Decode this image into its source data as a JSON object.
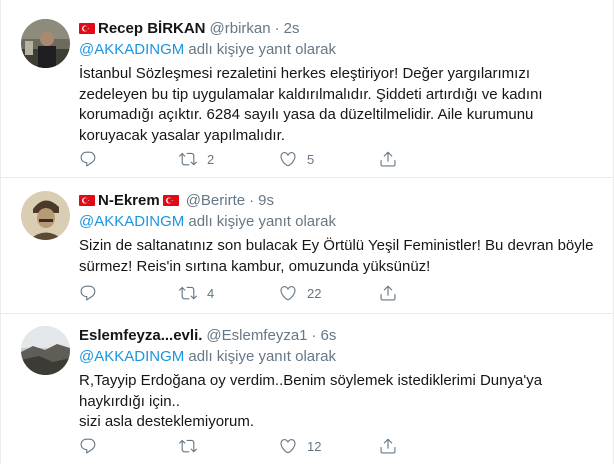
{
  "tweets": [
    {
      "name": "Recep BİRKAN",
      "handle": "@rbirkan",
      "time": "2s",
      "reply_mention": "@AKKADINGM",
      "reply_suffix": "adlı kişiye yanıt olarak",
      "lines": [
        "İstanbul Sözleşmesi rezaletini herkes eleştiriyor! Değer yargılarımızı",
        "zedeleyen bu tip uygulamalar kaldırılmalıdır. Şiddeti artırdığı ve kadını",
        "korumadığı açıktır. 6284 sayılı yasa da düzeltilmelidir. Aile kurumunu",
        "koruyacak yasalar yapılmalıdır."
      ],
      "reply_count": "",
      "retweet_count": "2",
      "like_count": "5"
    },
    {
      "name": "N-Ekrem",
      "handle": "@Berirte",
      "time": "9s",
      "reply_mention": "@AKKADINGM",
      "reply_suffix": "adlı kişiye yanıt olarak",
      "lines": [
        "Sizin de saltanatınız son bulacak Ey Örtülü Yeşil Feministler! Bu devran böyle",
        "sürmez! Reis'in sırtına kambur, omuzunda yüksünüz!"
      ],
      "reply_count": "",
      "retweet_count": "4",
      "like_count": "22"
    },
    {
      "name": "Eslemfeyza...evli.",
      "handle": "@Eslemfeyza1",
      "time": "6s",
      "reply_mention": "@AKKADINGM",
      "reply_suffix": "adlı kişiye yanıt olarak",
      "lines": [
        "R,Tayyip Erdoğana oy verdim..Benim söylemek istediklerimi Dunya'ya",
        "haykırdığı için..",
        "sizi asla desteklemiyorum."
      ],
      "reply_count": "",
      "retweet_count": "",
      "like_count": "12"
    }
  ],
  "colors": {
    "name": "#14171a",
    "secondary": "#657786",
    "mention": "#1b95e0",
    "divider": "#e6ecf0",
    "flag_red": "#e30a17"
  },
  "icons": [
    "reply-icon",
    "retweet-icon",
    "like-icon",
    "share-icon",
    "turkish-flag-icon"
  ]
}
